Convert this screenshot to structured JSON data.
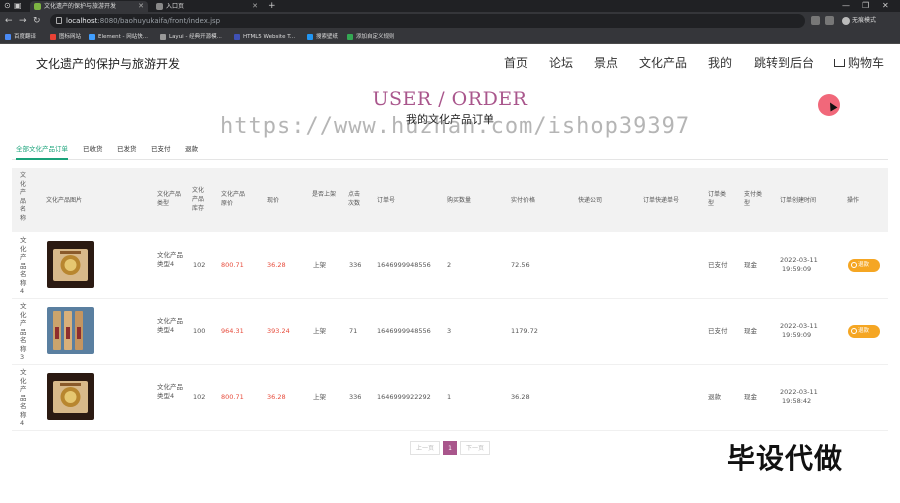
{
  "browser": {
    "tabs": [
      {
        "title": "文化遗产的保护与旅游开发",
        "active": true
      },
      {
        "title": "入口页",
        "active": false
      }
    ],
    "new_tab": "+",
    "url_host": "localhost",
    "url_path": ":8080/baohuyukaifa/front/index.jsp",
    "profile_label": "无痕模式",
    "bookmarks": [
      "百度翻译",
      "图标网站",
      "Element - 网站快...",
      "Layui - 经典开源模...",
      "HTML5 Website T...",
      "搜索壁纸",
      "添加自定义规则"
    ],
    "window_controls": [
      "—",
      "❐",
      "✕"
    ]
  },
  "site": {
    "title": "文化遗产的保护与旅游开发",
    "nav": [
      "首页",
      "论坛",
      "景点",
      "文化产品",
      "我的",
      "跳转到后台",
      "购物车"
    ]
  },
  "hero": {
    "title": "USER / ORDER",
    "subtitle": "我的文化产品订单"
  },
  "watermark": "https://www.huzhan.com/ishop39397",
  "order_tabs": [
    "全部文化产品订单",
    "已收货",
    "已发货",
    "已支付",
    "退款"
  ],
  "table": {
    "headers": [
      "文化产品名称",
      "文化产品图片",
      "文化产品类型",
      "文化产品库存",
      "文化产品原价",
      "现价",
      "是否上架",
      "点击次数",
      "订单号",
      "购买数量",
      "实付价格",
      "快递公司",
      "订单快递单号",
      "订单类型",
      "支付类型",
      "订单创建时间",
      "操作"
    ],
    "rows": [
      {
        "name": "文化产品名称4",
        "type": "文化产品类型4",
        "stock": "102",
        "orig": "800.71",
        "price": "36.28",
        "on_shelf": "上架",
        "clicks": "336",
        "order_no": "1646999948556",
        "qty": "2",
        "paid": "72.56",
        "courier": "",
        "tracking": "",
        "status": "已支付",
        "pay_type": "现金",
        "date": "2022-03-11",
        "time": "19:59:09",
        "action": "退款"
      },
      {
        "name": "文化产品名称3",
        "type": "文化产品类型4",
        "stock": "100",
        "orig": "964.31",
        "price": "393.24",
        "on_shelf": "上架",
        "clicks": "71",
        "order_no": "1646999948556",
        "qty": "3",
        "paid": "1179.72",
        "courier": "",
        "tracking": "",
        "status": "已支付",
        "pay_type": "现金",
        "date": "2022-03-11",
        "time": "19:59:09",
        "action": "退款"
      },
      {
        "name": "文化产品名称4",
        "type": "文化产品类型4",
        "stock": "102",
        "orig": "800.71",
        "price": "36.28",
        "on_shelf": "上架",
        "clicks": "336",
        "order_no": "1646999922292",
        "qty": "1",
        "paid": "36.28",
        "courier": "",
        "tracking": "",
        "status": "退款",
        "pay_type": "现金",
        "date": "2022-03-11",
        "time": "19:58:42",
        "action": ""
      }
    ]
  },
  "pager": {
    "prev": "上一页",
    "current": "1",
    "next": "下一页"
  },
  "corner_watermark": "毕设代做",
  "colors": {
    "accent": "#a9568c",
    "tab_active": "#1aa37a",
    "price_red": "#e74c3c",
    "pay_button": "#f5a623"
  }
}
